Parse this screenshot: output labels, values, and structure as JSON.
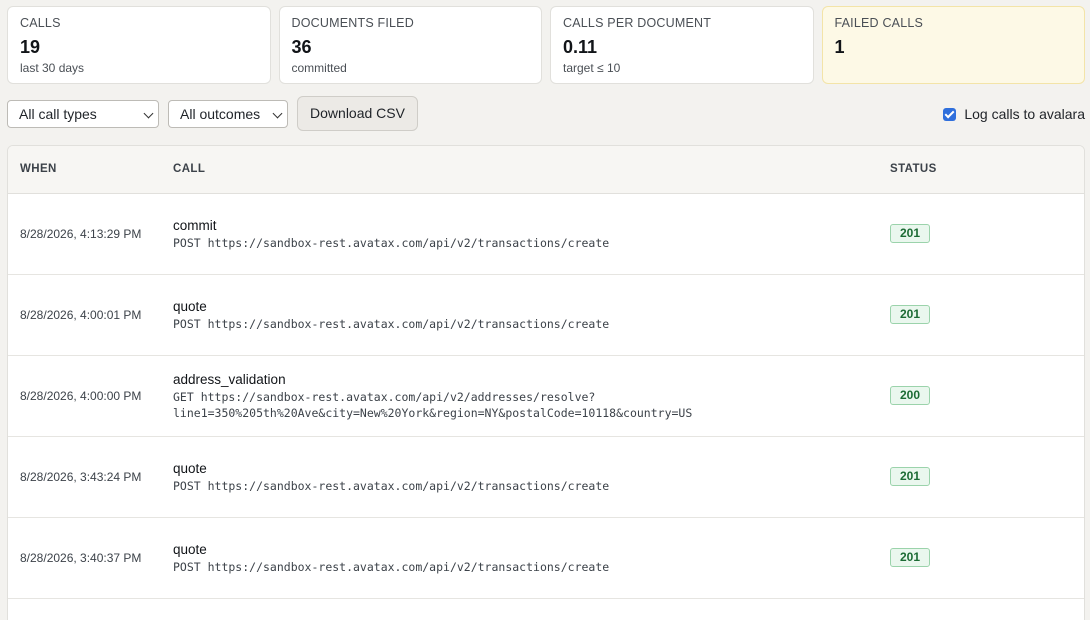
{
  "stats": [
    {
      "label": "CALLS",
      "value": "19",
      "sub": "last 30 days"
    },
    {
      "label": "DOCUMENTS FILED",
      "value": "36",
      "sub": "committed"
    },
    {
      "label": "CALLS PER DOCUMENT",
      "value": "0.11",
      "sub": "target ≤ 10"
    },
    {
      "label": "FAILED CALLS",
      "value": "1",
      "sub": ""
    }
  ],
  "toolbar": {
    "call_type_selected": "All call types",
    "outcome_selected": "All outcomes",
    "download_label": "Download CSV",
    "log_toggle_label": "Log calls to avalara",
    "log_toggle_checked": true
  },
  "table": {
    "headers": {
      "when": "WHEN",
      "call": "CALL",
      "status": "STATUS"
    },
    "rows": [
      {
        "when": "8/28/2026, 4:13:29 PM",
        "name": "commit",
        "request": "POST https://sandbox-rest.avatax.com/api/v2/transactions/create",
        "status": "201"
      },
      {
        "when": "8/28/2026, 4:00:01 PM",
        "name": "quote",
        "request": "POST https://sandbox-rest.avatax.com/api/v2/transactions/create",
        "status": "201"
      },
      {
        "when": "8/28/2026, 4:00:00 PM",
        "name": "address_validation",
        "request": "GET https://sandbox-rest.avatax.com/api/v2/addresses/resolve?\nline1=350%205th%20Ave&city=New%20York&region=NY&postalCode=10118&country=US",
        "status": "200"
      },
      {
        "when": "8/28/2026, 3:43:24 PM",
        "name": "quote",
        "request": "POST https://sandbox-rest.avatax.com/api/v2/transactions/create",
        "status": "201"
      },
      {
        "when": "8/28/2026, 3:40:37 PM",
        "name": "quote",
        "request": "POST https://sandbox-rest.avatax.com/api/v2/transactions/create",
        "status": "201"
      }
    ]
  }
}
